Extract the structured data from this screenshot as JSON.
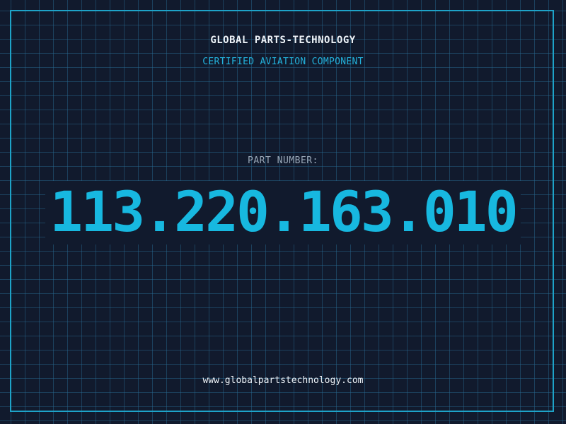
{
  "brand": {
    "name": "GLOBAL PARTS-TECHNOLOGY",
    "tagline": "CERTIFIED AVIATION COMPONENT"
  },
  "part": {
    "label": "PART NUMBER:",
    "number": "113.220.163.010"
  },
  "footer": {
    "url": "www.globalpartstechnology.com"
  },
  "colors": {
    "background": "#111a2d",
    "grid": "#296e96",
    "frame": "#1ea3c8",
    "accent": "#17b8e0",
    "text": "#eef3f8",
    "muted": "#9aa8b8"
  }
}
